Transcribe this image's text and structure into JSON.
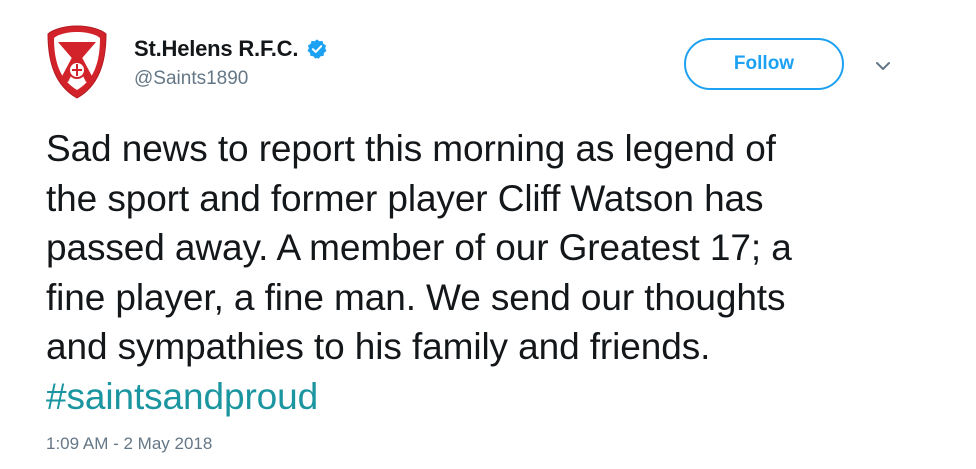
{
  "account": {
    "display_name": "St.Helens R.F.C.",
    "handle": "@Saints1890",
    "avatar_icon": "club-crest-icon",
    "verified_icon": "verified-badge-icon"
  },
  "actions": {
    "follow_label": "Follow",
    "menu_icon": "chevron-down-icon"
  },
  "tweet": {
    "lines": [
      "Sad news to report this morning as legend of",
      "the sport and former player Cliff Watson has",
      "passed away. A member of our Greatest 17; a",
      "fine player, a fine man. We send our thoughts",
      "and sympathies to his family and friends."
    ],
    "hashtag": "#saintsandproud",
    "timestamp": "1:09 AM - 2 May 2018"
  },
  "colors": {
    "accent": "#1da1f2",
    "hashtag": "#1b95a0",
    "secondary_text": "#657786",
    "primary_text": "#14171a",
    "crest_red": "#d2232a"
  }
}
